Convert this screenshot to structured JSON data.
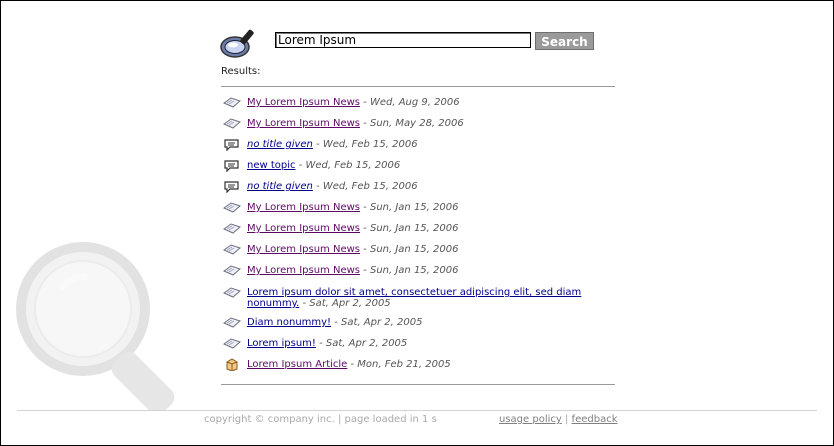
{
  "search": {
    "value": "Lorem Ipsum",
    "button_label": "Search"
  },
  "results_label": "Results:",
  "results": [
    {
      "icon": "newspaper-icon",
      "title": "My Lorem Ipsum News",
      "date": "Wed, Aug 9, 2006",
      "style": "visited"
    },
    {
      "icon": "newspaper-icon",
      "title": "My Lorem Ipsum News",
      "date": "Sun, May 28, 2006",
      "style": "visited"
    },
    {
      "icon": "speech-bubble-icon",
      "title": "no title given",
      "date": "Wed, Feb 15, 2006",
      "style": "italic"
    },
    {
      "icon": "speech-bubble-icon",
      "title": "new topic",
      "date": "Wed, Feb 15, 2006",
      "style": "normal"
    },
    {
      "icon": "speech-bubble-icon",
      "title": "no title given",
      "date": "Wed, Feb 15, 2006",
      "style": "italic"
    },
    {
      "icon": "newspaper-icon",
      "title": "My Lorem Ipsum News",
      "date": "Sun, Jan 15, 2006",
      "style": "visited"
    },
    {
      "icon": "newspaper-icon",
      "title": "My Lorem Ipsum News",
      "date": "Sun, Jan 15, 2006",
      "style": "visited"
    },
    {
      "icon": "newspaper-icon",
      "title": "My Lorem Ipsum News",
      "date": "Sun, Jan 15, 2006",
      "style": "visited"
    },
    {
      "icon": "newspaper-icon",
      "title": "My Lorem Ipsum News",
      "date": "Sun, Jan 15, 2006",
      "style": "visited"
    },
    {
      "icon": "newspaper-icon",
      "title": "Lorem ipsum dolor sit amet, consectetuer adipiscing elit, sed diam nonummy.",
      "date": "Sat, Apr 2, 2005",
      "style": "normal"
    },
    {
      "icon": "newspaper-icon",
      "title": "Diam nonummy!",
      "date": "Sat, Apr 2, 2005",
      "style": "normal"
    },
    {
      "icon": "newspaper-icon",
      "title": "Lorem ipsum!",
      "date": "Sat, Apr 2, 2005",
      "style": "normal"
    },
    {
      "icon": "article-box-icon",
      "title": "Lorem Ipsum Article",
      "date": "Mon, Feb 21, 2005",
      "style": "visited"
    }
  ],
  "separator": " - ",
  "footer": {
    "copyright": "copyright © company inc. | page loaded in 1 s",
    "usage_policy": "usage policy",
    "divider": "|",
    "feedback": "feedback"
  },
  "colors": {
    "link": "#00008b",
    "visited_link": "#5c0a63",
    "button_bg": "#9a9a9a"
  }
}
